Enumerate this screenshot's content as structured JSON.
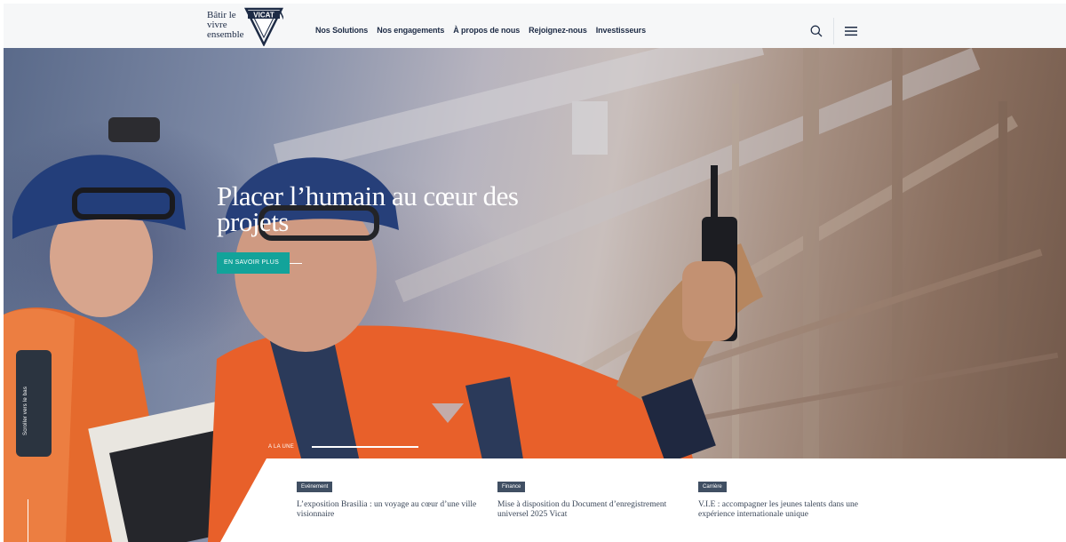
{
  "brand": {
    "tagline": "Bâtir le vivre ensemble",
    "name": "VICAT",
    "colors": {
      "navy": "#1d2b45",
      "teal": "#13a39a",
      "badge": "#404f63"
    }
  },
  "nav": {
    "items": [
      {
        "label": "Nos Solutions"
      },
      {
        "label": "Nos engagements"
      },
      {
        "label": "À propos de nous"
      },
      {
        "label": "Rejoignez-nous"
      },
      {
        "label": "Investisseurs"
      }
    ],
    "icons": {
      "search": "search-icon",
      "menu": "menu-icon"
    }
  },
  "hero": {
    "title": "Placer l’humain au cœur des projets",
    "cta_label": "EN SAVOIR PLUS",
    "scroll_label": "Scroller vers le bas"
  },
  "news": {
    "kicker": "A LA UNE",
    "items": [
      {
        "category": "Evénement",
        "title": "L’exposition Brasilia : un voyage au cœur d’une ville visionnaire"
      },
      {
        "category": "Finance",
        "title": "Mise à disposition du Document d’enregistrement universel 2025 Vicat"
      },
      {
        "category": "Carrière",
        "title": "V.I.E : accompagner les jeunes talents dans une expérience internationale unique"
      }
    ]
  }
}
